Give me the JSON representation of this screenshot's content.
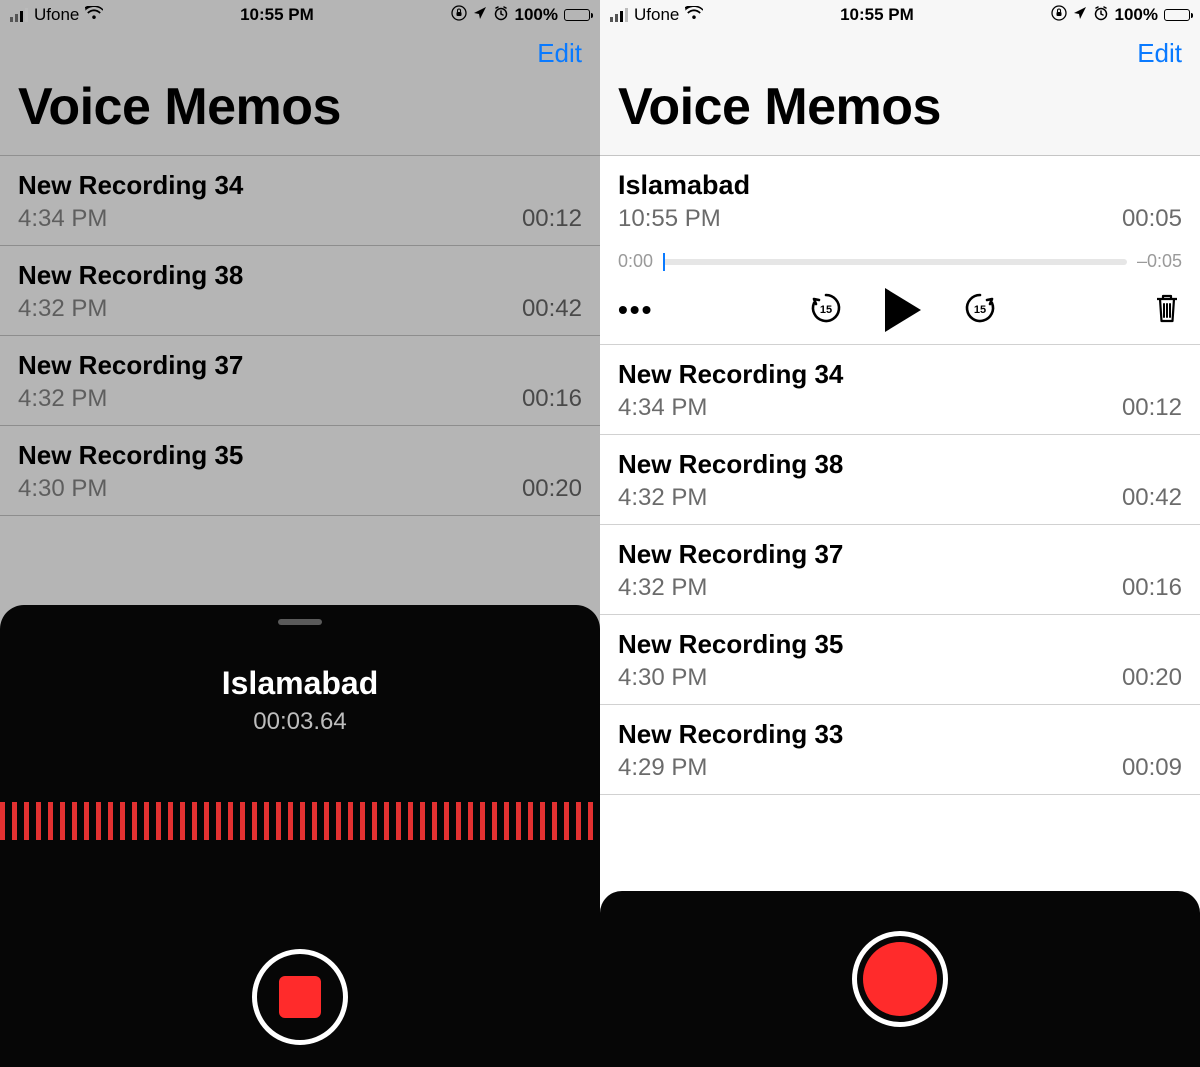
{
  "status": {
    "carrier": "Ufone",
    "time": "10:55 PM",
    "battery": "100%"
  },
  "nav": {
    "edit": "Edit"
  },
  "title": "Voice Memos",
  "left": {
    "list": [
      {
        "title": "New Recording 34",
        "time": "4:34 PM",
        "dur": "00:12"
      },
      {
        "title": "New Recording 38",
        "time": "4:32 PM",
        "dur": "00:42"
      },
      {
        "title": "New Recording 37",
        "time": "4:32 PM",
        "dur": "00:16"
      },
      {
        "title": "New Recording 35",
        "time": "4:30 PM",
        "dur": "00:20"
      }
    ],
    "recording": {
      "name": "Islamabad",
      "elapsed": "00:03.64"
    }
  },
  "right": {
    "expanded": {
      "title": "Islamabad",
      "time": "10:55 PM",
      "dur": "00:05",
      "scrub_left": "0:00",
      "scrub_right": "–0:05"
    },
    "list": [
      {
        "title": "New Recording 34",
        "time": "4:34 PM",
        "dur": "00:12"
      },
      {
        "title": "New Recording 38",
        "time": "4:32 PM",
        "dur": "00:42"
      },
      {
        "title": "New Recording 37",
        "time": "4:32 PM",
        "dur": "00:16"
      },
      {
        "title": "New Recording 35",
        "time": "4:30 PM",
        "dur": "00:20"
      },
      {
        "title": "New Recording 33",
        "time": "4:29 PM",
        "dur": "00:09"
      }
    ]
  }
}
